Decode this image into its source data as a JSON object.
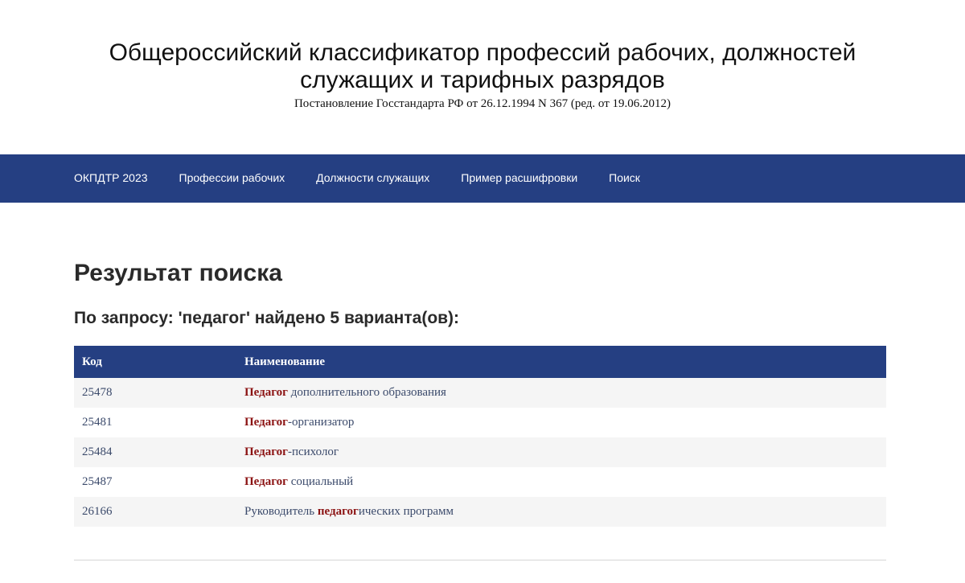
{
  "header": {
    "title_line1": "Общероссийский классификатор профессий рабочих, должностей",
    "title_line2": "служащих и тарифных разрядов",
    "subtitle": "Постановление Госстандарта РФ от 26.12.1994 N 367 (ред. от 19.06.2012)"
  },
  "nav": {
    "items": [
      {
        "label": "ОКПДТР 2023"
      },
      {
        "label": "Профессии рабочих"
      },
      {
        "label": "Должности служащих"
      },
      {
        "label": "Пример расшифровки"
      },
      {
        "label": "Поиск"
      }
    ]
  },
  "main": {
    "page_title": "Результат поиска",
    "query_summary": "По запросу: 'педагог' найдено 5 варианта(ов):"
  },
  "table": {
    "headers": {
      "code": "Код",
      "name": "Наименование"
    },
    "rows": [
      {
        "code": "25478",
        "pre": "",
        "hl": "Педагог",
        "post": " дополнительного образования"
      },
      {
        "code": "25481",
        "pre": "",
        "hl": "Педагог",
        "post": "-организатор"
      },
      {
        "code": "25484",
        "pre": "",
        "hl": "Педагог",
        "post": "-психолог"
      },
      {
        "code": "25487",
        "pre": "",
        "hl": "Педагог",
        "post": " социальный"
      },
      {
        "code": "26166",
        "pre": "Руководитель ",
        "hl": "педагог",
        "post": "ических программ"
      }
    ]
  },
  "colors": {
    "nav_bg": "#253f82",
    "highlight": "#8b1212",
    "link": "#3b4a6b"
  }
}
